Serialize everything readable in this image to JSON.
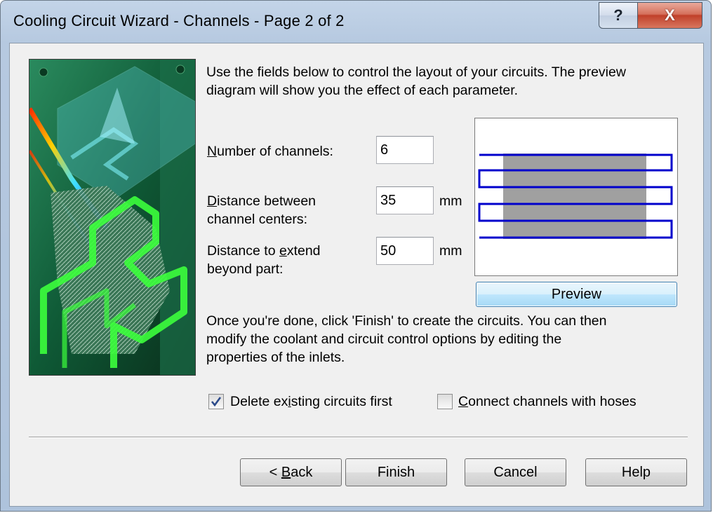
{
  "window": {
    "title": "Cooling Circuit Wizard - Channels - Page 2 of 2",
    "help_glyph": "?",
    "close_glyph": "X"
  },
  "intro_line1": "Use the fields below to control the layout of your circuits. The preview",
  "intro_line2": "diagram will show you the effect of each parameter.",
  "fields": {
    "num_channels": {
      "label_accel": "N",
      "label_rest": "umber of channels:",
      "value": "6"
    },
    "distance_between": {
      "label_accel": "D",
      "label_line1_rest": "istance between",
      "label_line2": "channel centers:",
      "value": "35",
      "unit": "mm"
    },
    "distance_extend": {
      "label_line1_pre": "Distance to ",
      "label_accel": "e",
      "label_line1_post": "xtend",
      "label_line2": "beyond part:",
      "value": "50",
      "unit": "mm"
    }
  },
  "preview_button": "Preview",
  "finish_line1": "Once you're done, click 'Finish' to create the circuits.  You can then",
  "finish_line2": "modify the coolant and circuit control options by editing the",
  "finish_line3": "properties of the inlets.",
  "checkboxes": {
    "delete_existing": {
      "label_pre": "Delete ex",
      "label_accel": "i",
      "label_post": "sting circuits first",
      "checked": true
    },
    "connect_hoses": {
      "label_accel": "C",
      "label_rest": "onnect channels with hoses",
      "checked": false
    }
  },
  "buttons": {
    "back_pre": "< ",
    "back_accel": "B",
    "back_post": "ack",
    "finish": "Finish",
    "cancel": "Cancel",
    "help": "Help"
  },
  "colors": {
    "channel_line": "#0000cc",
    "part_fill": "#a0a0a0",
    "checkmark": "#2b4a8a"
  }
}
